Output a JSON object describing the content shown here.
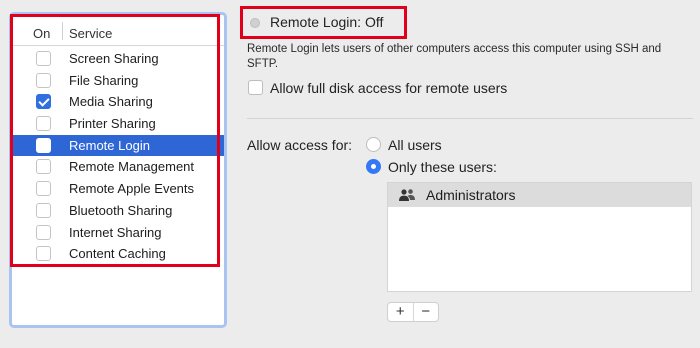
{
  "service_list": {
    "col_on": "On",
    "col_service": "Service",
    "items": [
      {
        "label": "Screen Sharing",
        "checked": false,
        "selected": false
      },
      {
        "label": "File Sharing",
        "checked": false,
        "selected": false
      },
      {
        "label": "Media Sharing",
        "checked": true,
        "selected": false
      },
      {
        "label": "Printer Sharing",
        "checked": false,
        "selected": false
      },
      {
        "label": "Remote Login",
        "checked": false,
        "selected": true
      },
      {
        "label": "Remote Management",
        "checked": false,
        "selected": false
      },
      {
        "label": "Remote Apple Events",
        "checked": false,
        "selected": false
      },
      {
        "label": "Bluetooth Sharing",
        "checked": false,
        "selected": false
      },
      {
        "label": "Internet Sharing",
        "checked": false,
        "selected": false
      },
      {
        "label": "Content Caching",
        "checked": false,
        "selected": false
      }
    ]
  },
  "detail": {
    "status": "Remote Login: Off",
    "status_dot_icon": "status-dot-icon",
    "description": "Remote Login lets users of other computers access this computer using SSH and SFTP.",
    "full_disk_access_label": "Allow full disk access for remote users",
    "full_disk_access_checked": false,
    "allow_access_label": "Allow access for:",
    "radio_all_users": "All users",
    "radio_only_these": "Only these users:",
    "selected_access": "only_these_users",
    "users": [
      {
        "name": "Administrators",
        "icon": "group-icon"
      }
    ],
    "add_button": "+",
    "remove_button": "−"
  },
  "colors": {
    "selection": "#2f66d6",
    "highlight_border": "#e0001b",
    "radio_accent": "#3478f6"
  }
}
